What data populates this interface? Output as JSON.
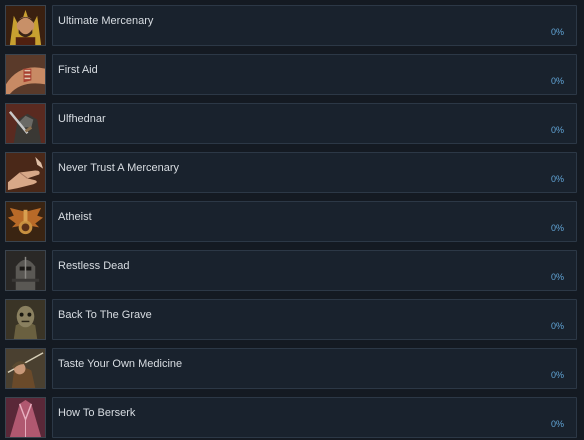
{
  "achievements": [
    {
      "name": "Ultimate Mercenary",
      "progress": "0%",
      "icon": "mercenary-portrait-icon"
    },
    {
      "name": "First Aid",
      "progress": "0%",
      "icon": "bandaged-arm-icon"
    },
    {
      "name": "Ulfhednar",
      "progress": "0%",
      "icon": "wolf-warrior-icon"
    },
    {
      "name": "Never Trust A Mercenary",
      "progress": "0%",
      "icon": "handshake-icon"
    },
    {
      "name": "Atheist",
      "progress": "0%",
      "icon": "winged-idol-icon"
    },
    {
      "name": "Restless Dead",
      "progress": "0%",
      "icon": "armored-undead-icon"
    },
    {
      "name": "Back To The Grave",
      "progress": "0%",
      "icon": "zombie-icon"
    },
    {
      "name": "Taste Your Own Medicine",
      "progress": "0%",
      "icon": "archer-icon"
    },
    {
      "name": "How To Berserk",
      "progress": "0%",
      "icon": "berserker-icon"
    }
  ]
}
